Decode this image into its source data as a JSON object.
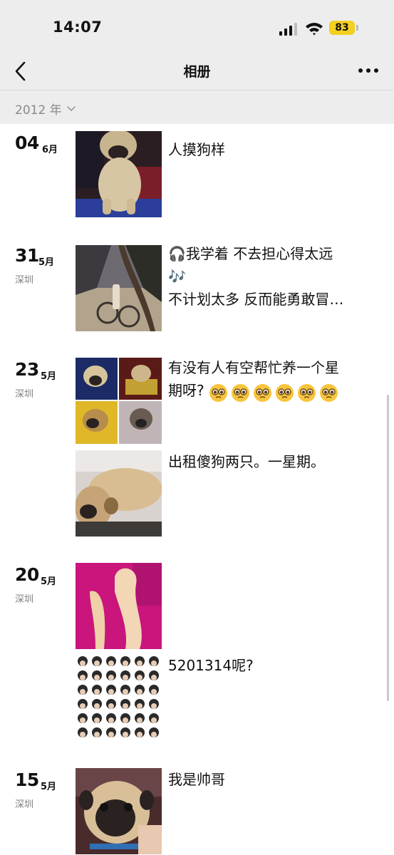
{
  "status": {
    "time": "14:07",
    "battery": "83"
  },
  "nav": {
    "title": "相册"
  },
  "year": {
    "label": "2012 年"
  },
  "entries": [
    {
      "day": "04",
      "month": "6月",
      "location": "",
      "text": "人摸狗样"
    },
    {
      "day": "31",
      "month": "5月",
      "location": "深圳",
      "text": "🎧我学着 不去担心得太远\n🎶\n不计划太多 反而能勇敢冒…"
    },
    {
      "day": "23",
      "month": "5月",
      "location": "深圳",
      "text": "有没有人有空帮忙养一个星\n期呀?",
      "text2": "出租傻狗两只。一星期。"
    },
    {
      "day": "20",
      "month": "5月",
      "location": "深圳",
      "text": "5201314呢?"
    },
    {
      "day": "15",
      "month": "5月",
      "location": "深圳",
      "text": "我是帅哥"
    }
  ],
  "icons": {
    "back": "chevron-left-icon",
    "more": "more-dots-icon",
    "signal": "signal-icon",
    "wifi": "wifi-icon",
    "battery": "battery-icon",
    "pleading_emoji": "pleading-face-icon"
  }
}
